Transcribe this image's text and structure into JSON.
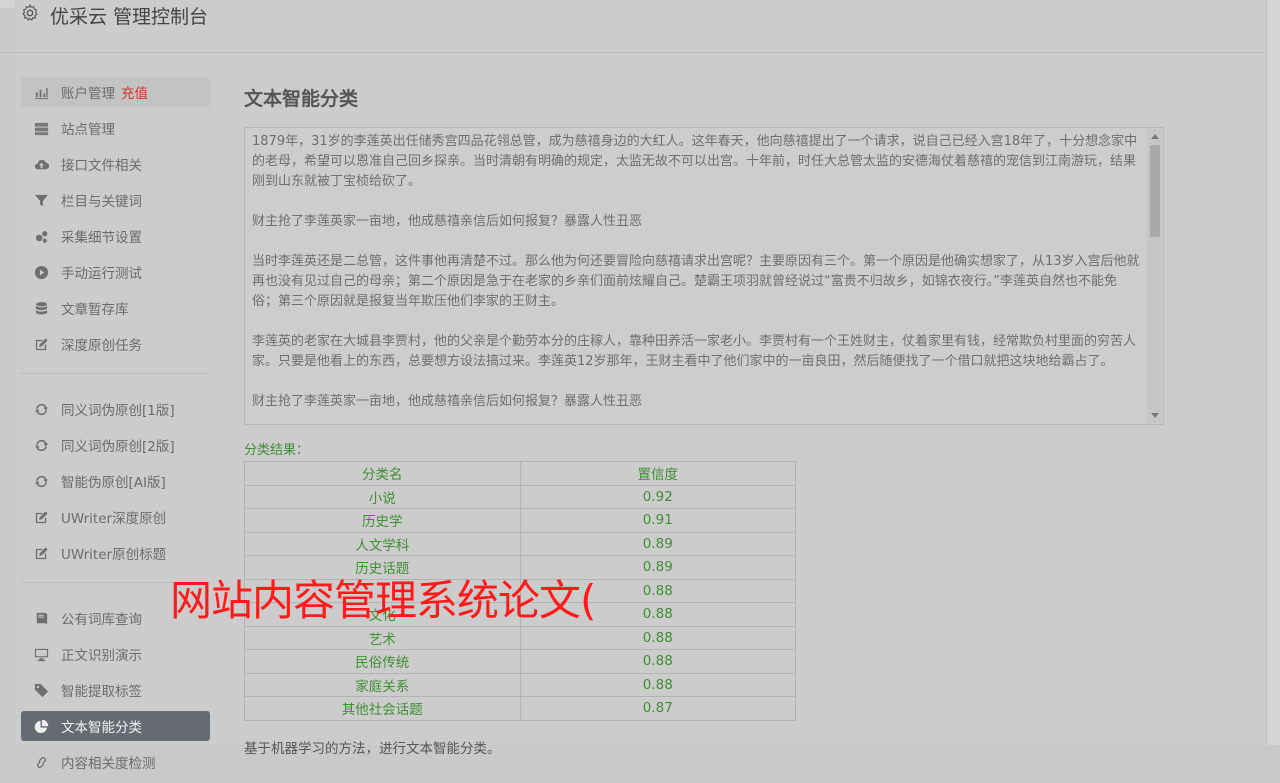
{
  "app": {
    "title": "优采云 管理控制台",
    "icon": "gear-icon"
  },
  "sidebar": {
    "group1": [
      {
        "label": "账户管理",
        "tag": "充值",
        "icon": "bar-chart-icon",
        "state": "hover"
      },
      {
        "label": "站点管理",
        "icon": "server-icon"
      },
      {
        "label": "接口文件相关",
        "icon": "cloud-upload-icon"
      },
      {
        "label": "栏目与关键词",
        "icon": "filter-icon"
      },
      {
        "label": "采集细节设置",
        "icon": "cogs-icon"
      },
      {
        "label": "手动运行测试",
        "icon": "play-circle-icon"
      },
      {
        "label": "文章暂存库",
        "icon": "database-icon"
      },
      {
        "label": "深度原创任务",
        "icon": "edit-icon"
      }
    ],
    "group2": [
      {
        "label": "同义词伪原创[1版]",
        "icon": "refresh-icon"
      },
      {
        "label": "同义词伪原创[2版]",
        "icon": "refresh-icon"
      },
      {
        "label": "智能伪原创[AI版]",
        "icon": "refresh-icon"
      },
      {
        "label": "UWriter深度原创",
        "icon": "edit-icon"
      },
      {
        "label": "UWriter原创标题",
        "icon": "edit-icon"
      }
    ],
    "group3": [
      {
        "label": "公有词库查询",
        "icon": "book-icon"
      },
      {
        "label": "正文识别演示",
        "icon": "monitor-icon"
      },
      {
        "label": "智能提取标签",
        "icon": "tag-icon"
      },
      {
        "label": "文本智能分类",
        "icon": "pie-chart-icon",
        "state": "active"
      },
      {
        "label": "内容相关度检测",
        "icon": "link-icon"
      }
    ]
  },
  "main": {
    "title": "文本智能分类",
    "article": [
      "1879年，31岁的李莲英出任储秀宫四品花翎总管，成为慈禧身边的大红人。这年春天，他向慈禧提出了一个请求，说自己已经入宫18年了，十分想念家中的老母，希望可以恩准自己回乡探亲。当时清朝有明确的规定，太监无故不可以出宫。十年前，时任大总管太监的安德海仗着慈禧的宠信到江南游玩，结果刚到山东就被丁宝桢给砍了。",
      "财主抢了李莲英家一亩地，他成慈禧亲信后如何报复？暴露人性丑恶",
      "当时李莲英还是二总管，这件事他再清楚不过。那么他为何还要冒险向慈禧请求出宫呢？主要原因有三个。第一个原因是他确实想家了，从13岁入宫后他就再也没有见过自己的母亲；第二个原因是急于在老家的乡亲们面前炫耀自己。楚霸王项羽就曾经说过“富贵不归故乡，如锦衣夜行。”李莲英自然也不能免俗；第三个原因就是报复当年欺压他们李家的王财主。",
      "李莲英的老家在大城县李贾村，他的父亲是个勤劳本分的庄稼人，靠种田养活一家老小。李贾村有一个王姓财主，仗着家里有钱，经常欺负村里面的穷苦人家。只要是他看上的东西，总要想方设法搞过来。李莲英12岁那年，王财主看中了他们家中的一亩良田，然后随便找了一个借口就把这块地给霸占了。",
      "财主抢了李莲英家一亩地，他成慈禧亲信后如何报复？暴露人性丑恶"
    ],
    "result_label": "分类结果：",
    "table": {
      "headers": [
        "分类名",
        "置信度"
      ],
      "rows": [
        [
          "小说",
          "0.92"
        ],
        [
          "历史学",
          "0.91"
        ],
        [
          "人文学科",
          "0.89"
        ],
        [
          "历史话题",
          "0.89"
        ],
        [
          "",
          "0.88"
        ],
        [
          "文化",
          "0.88"
        ],
        [
          "艺术",
          "0.88"
        ],
        [
          "民俗传统",
          "0.88"
        ],
        [
          "家庭关系",
          "0.88"
        ],
        [
          "其他社会话题",
          "0.87"
        ]
      ]
    },
    "footer_note": "基于机器学习的方法，进行文本智能分类。"
  },
  "watermark": "网站内容管理系统论文(",
  "colors": {
    "active_bg": "#656a73",
    "result_green": "#3f8e34",
    "tag_red": "#c83a2a",
    "watermark_red": "#ff1a1a"
  }
}
